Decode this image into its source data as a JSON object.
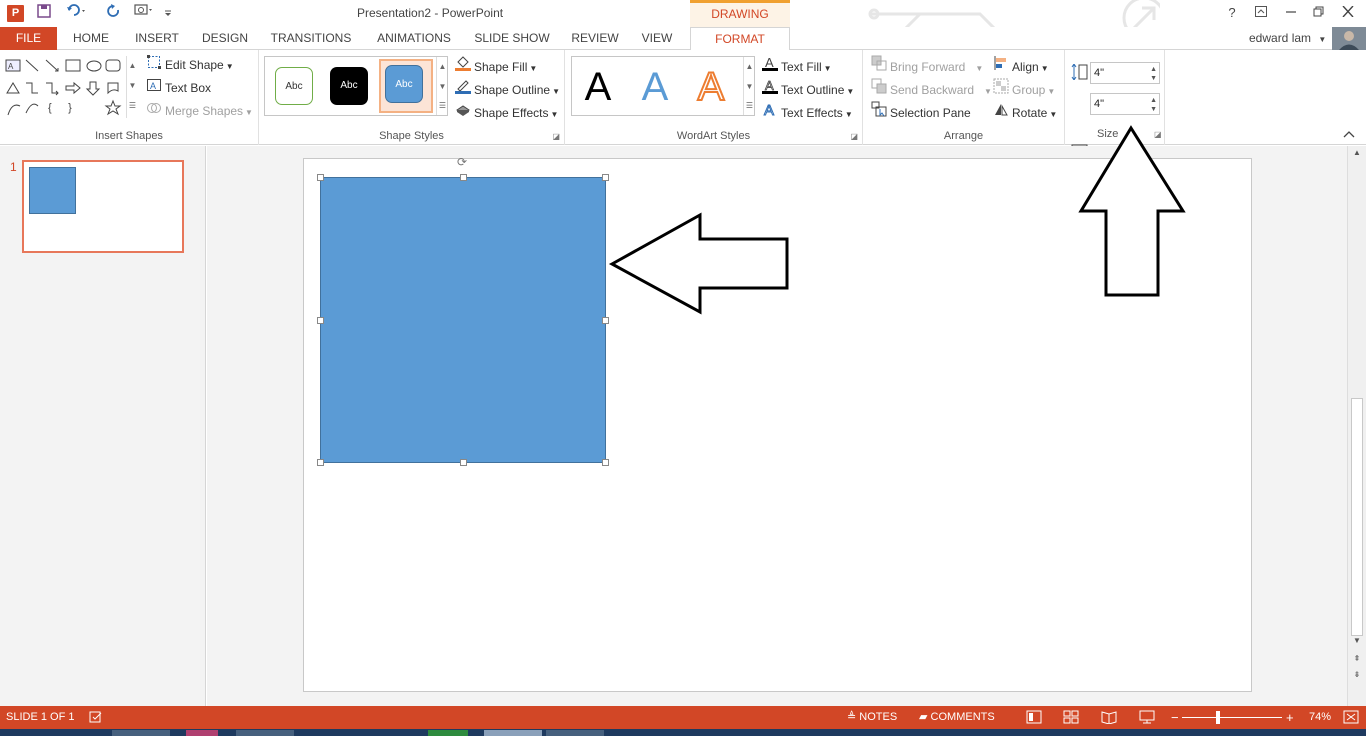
{
  "titlebar": {
    "app_icon": "P",
    "title": "Presentation2 - PowerPoint",
    "contextual_group": "DRAWING TOOLS",
    "help": "?",
    "icons": [
      "save-icon",
      "undo-icon",
      "redo-icon",
      "present-icon",
      "customize-icon",
      "help-icon",
      "ribbon-display-icon",
      "minimize-icon",
      "restore-icon",
      "close-icon"
    ]
  },
  "tabs": {
    "file": "FILE",
    "home": "HOME",
    "insert": "INSERT",
    "design": "DESIGN",
    "transitions": "TRANSITIONS",
    "animations": "ANIMATIONS",
    "slideshow": "SLIDE SHOW",
    "review": "REVIEW",
    "view": "VIEW",
    "format": "FORMAT",
    "user": "edward lam"
  },
  "ribbon": {
    "insert_shapes": {
      "label": "Insert Shapes",
      "edit_shape": "Edit Shape",
      "text_box": "Text Box",
      "merge_shapes": "Merge Shapes"
    },
    "shape_styles": {
      "label": "Shape Styles",
      "swatch_text": "Abc",
      "shape_fill": "Shape Fill",
      "shape_outline": "Shape Outline",
      "shape_effects": "Shape Effects"
    },
    "wordart": {
      "label": "WordArt Styles",
      "letter": "A",
      "text_fill": "Text Fill",
      "text_outline": "Text Outline",
      "text_effects": "Text Effects"
    },
    "arrange": {
      "label": "Arrange",
      "bring_forward": "Bring Forward",
      "send_backward": "Send Backward",
      "selection_pane": "Selection Pane",
      "align": "Align",
      "group": "Group",
      "rotate": "Rotate"
    },
    "size": {
      "label": "Size",
      "height": "4\"",
      "width": "4\""
    }
  },
  "thumbnails": {
    "slide_number": "1"
  },
  "statusbar": {
    "slide_info": "SLIDE 1 OF 1",
    "notes": "NOTES",
    "comments": "COMMENTS",
    "zoom_minus": "−",
    "zoom_plus": "+",
    "zoom": "74%"
  },
  "colors": {
    "accent": "#d24726",
    "shape_fill": "#5b9bd5",
    "shape_border": "#41719c"
  }
}
